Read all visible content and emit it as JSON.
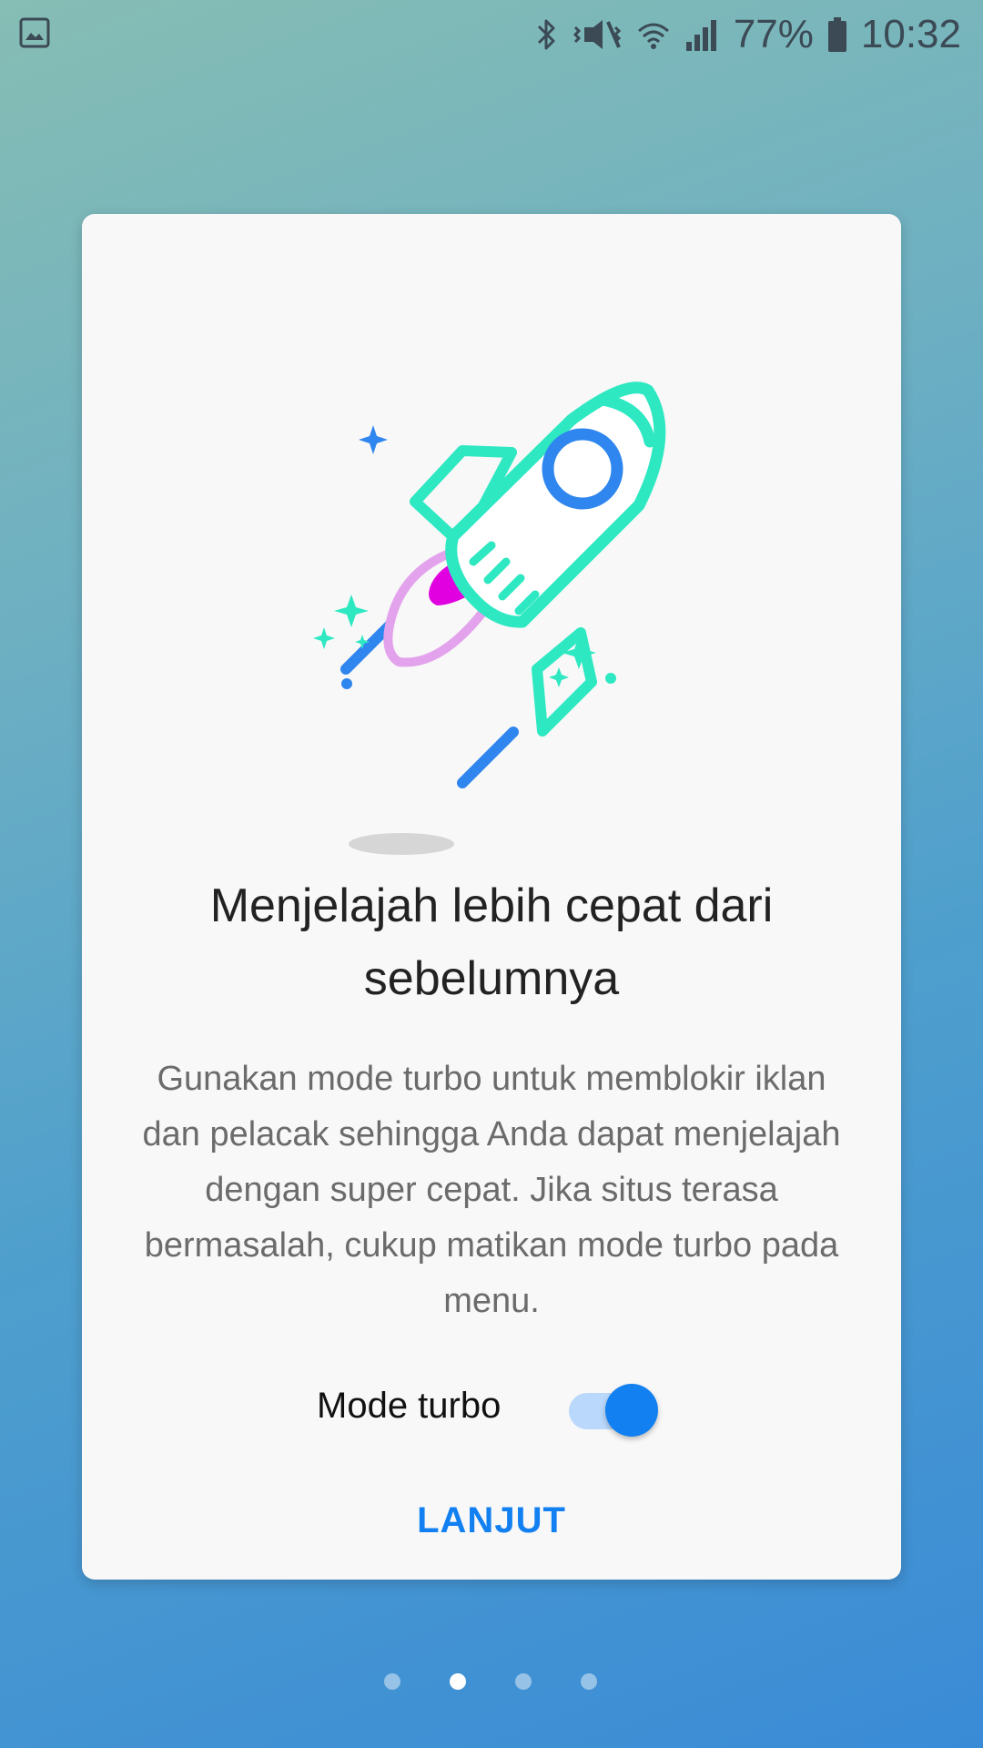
{
  "status_bar": {
    "battery_percent": "77%",
    "time": "10:32",
    "left_icon": "gallery-icon",
    "right_icons": [
      "bluetooth-icon",
      "vibrate-icon",
      "wifi-icon",
      "signal-icon",
      "battery-icon"
    ]
  },
  "onboarding": {
    "illustration": "rocket-illustration",
    "title": "Menjelajah lebih cepat dari sebelumnya",
    "description": "Gunakan mode turbo untuk memblokir iklan dan pelacak sehingga Anda dapat menjelajah dengan super cepat. Jika situs terasa bermasalah, cukup matikan mode turbo pada menu.",
    "toggle_label": "Mode turbo",
    "toggle_on": true,
    "next_label": "LANJUT"
  },
  "pager": {
    "count": 4,
    "active_index": 1
  },
  "colors": {
    "accent": "#1380f1",
    "rocket_green": "#2ee8c2",
    "rocket_blue": "#2f86ee",
    "flame_magenta": "#e000e0",
    "flame_outline": "#e3a2ec"
  }
}
